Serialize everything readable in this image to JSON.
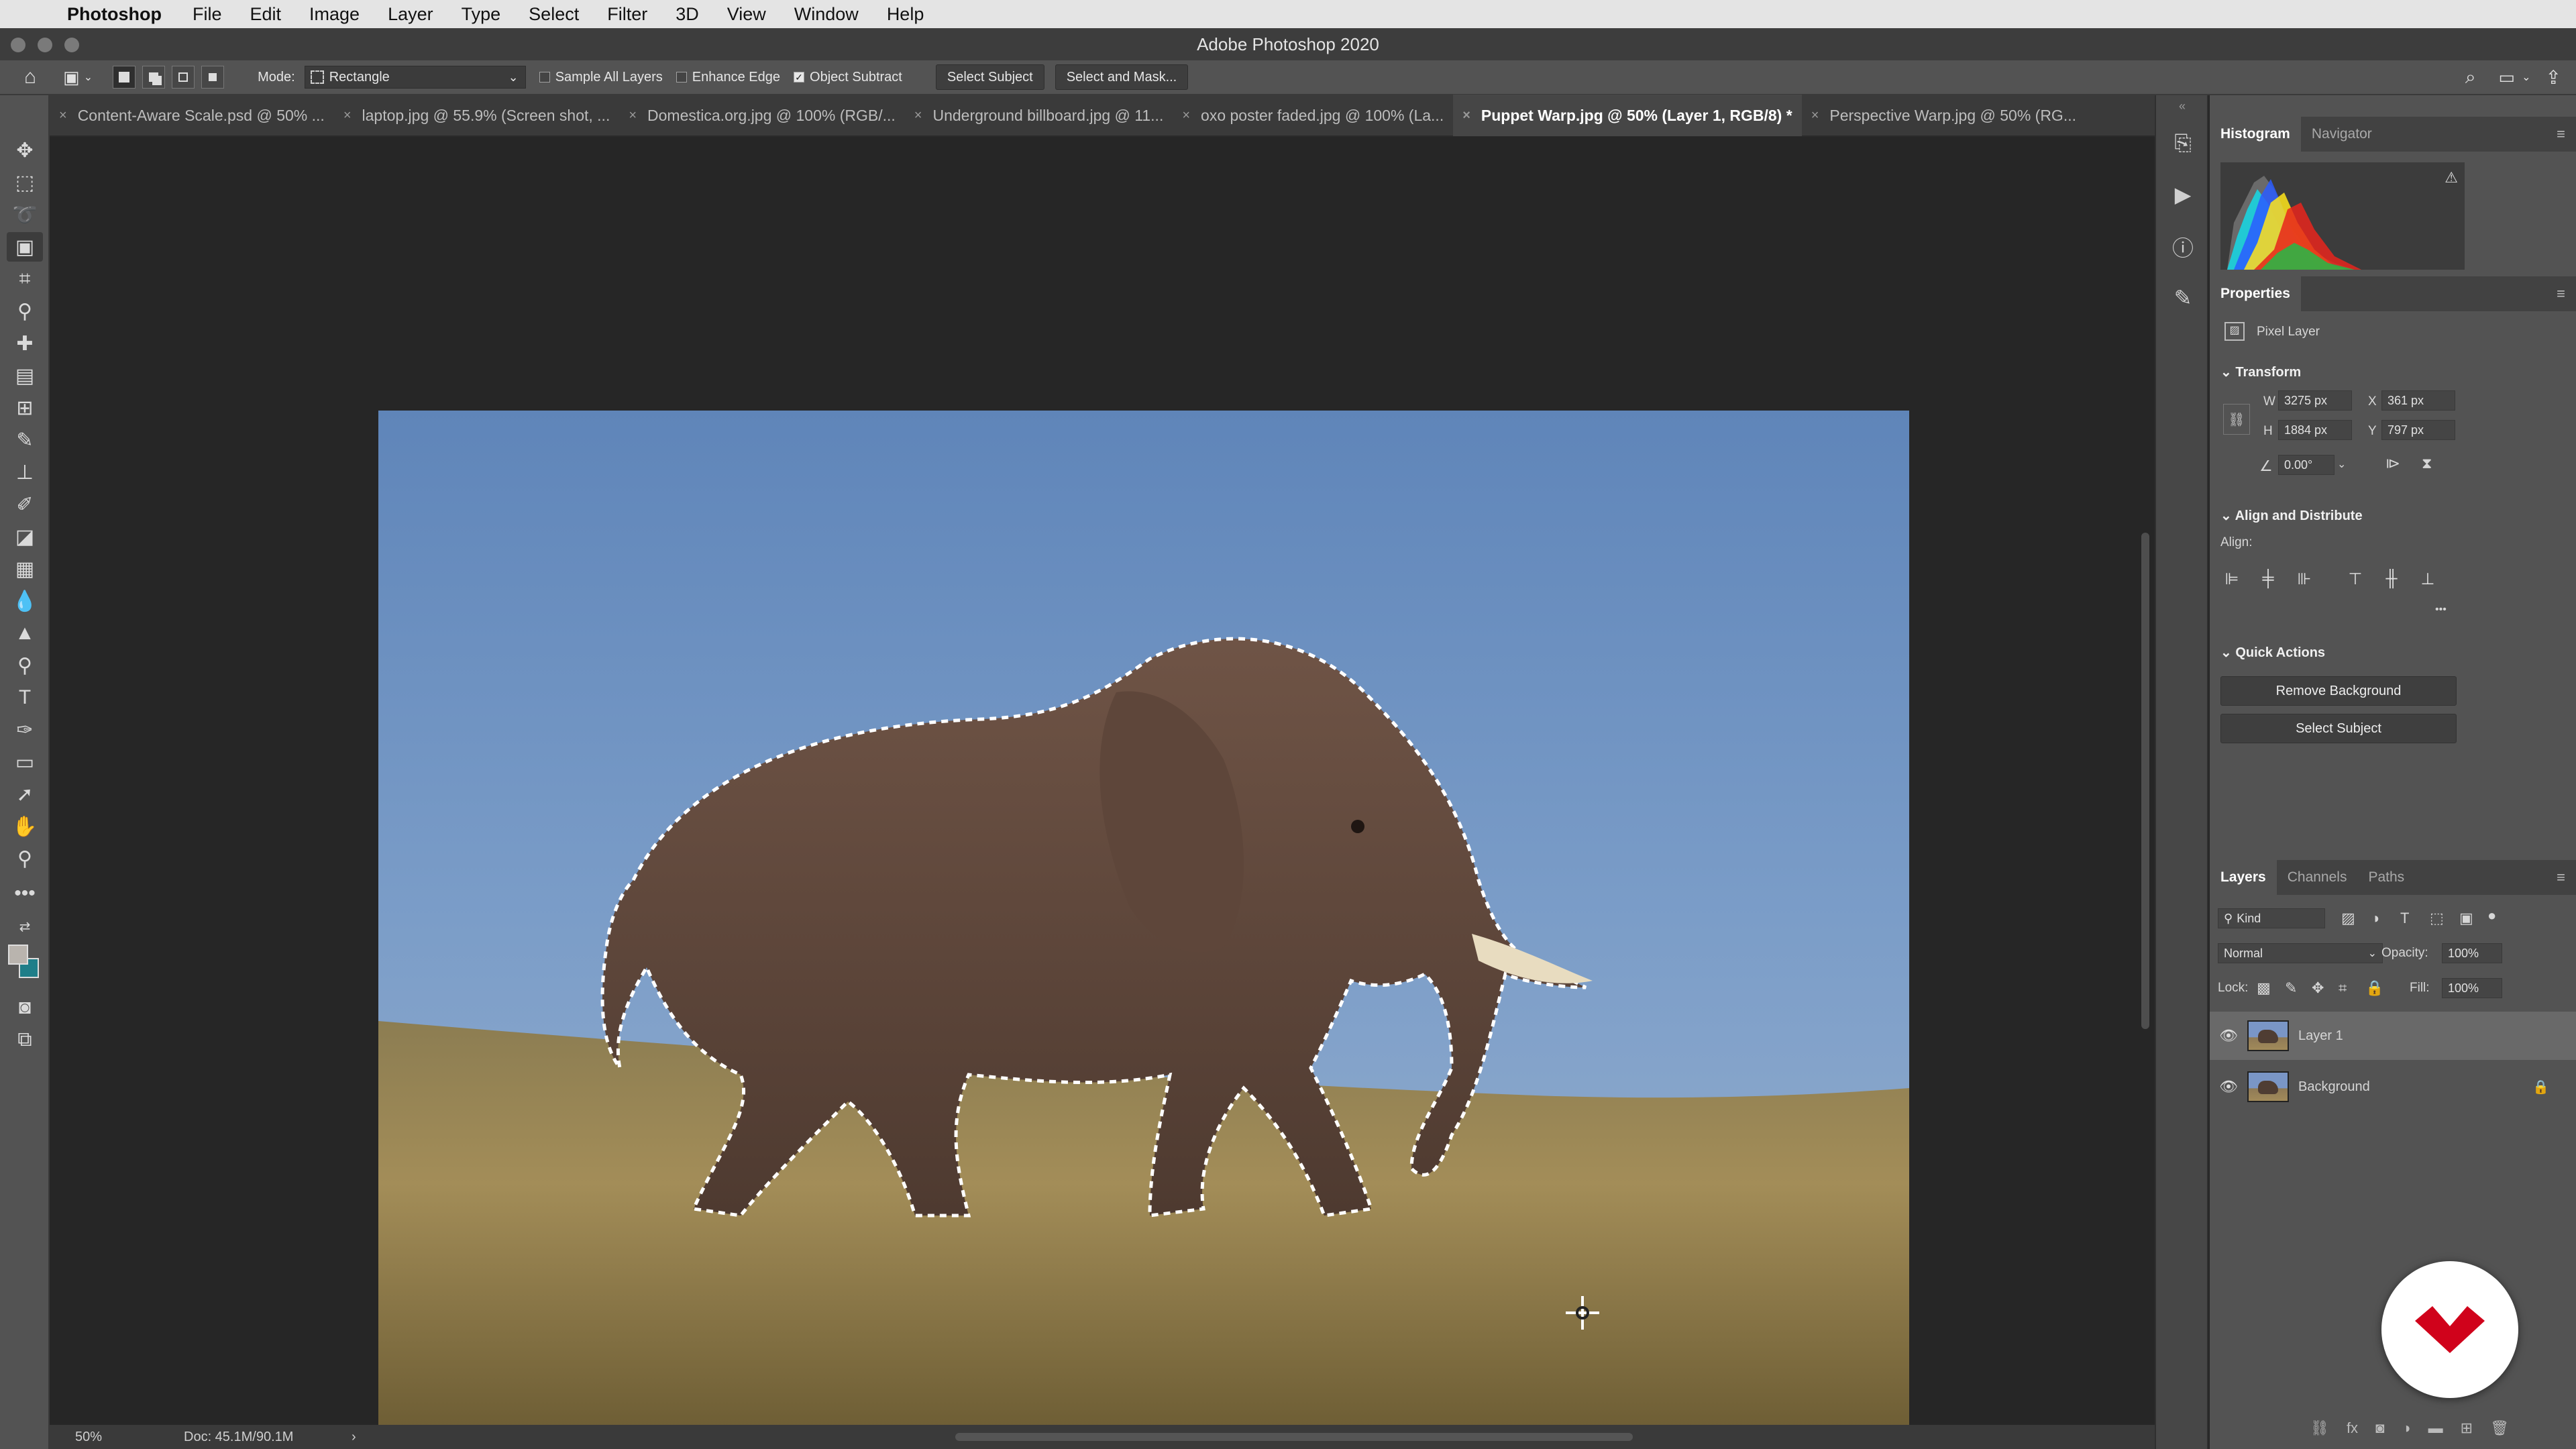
{
  "menubar": {
    "app_name": "Photoshop",
    "items": [
      "File",
      "Edit",
      "Image",
      "Layer",
      "Type",
      "Select",
      "Filter",
      "3D",
      "View",
      "Window",
      "Help"
    ]
  },
  "window": {
    "title": "Adobe Photoshop 2020"
  },
  "options": {
    "mode_label": "Mode:",
    "mode_value": "Rectangle",
    "sample_all_layers": "Sample All Layers",
    "sample_all_layers_checked": false,
    "enhance_edge": "Enhance Edge",
    "enhance_edge_checked": false,
    "object_subtract": "Object Subtract",
    "object_subtract_checked": true,
    "select_subject": "Select Subject",
    "select_and_mask": "Select and Mask..."
  },
  "tabs": [
    {
      "label": "Content-Aware Scale.psd @ 50% ...",
      "active": false
    },
    {
      "label": "laptop.jpg @ 55.9% (Screen shot, ...",
      "active": false
    },
    {
      "label": "Domestica.org.jpg @ 100% (RGB/...",
      "active": false
    },
    {
      "label": "Underground billboard.jpg @ 11...",
      "active": false
    },
    {
      "label": "oxo poster faded.jpg @ 100% (La...",
      "active": false
    },
    {
      "label": "Puppet Warp.jpg @ 50% (Layer 1, RGB/8) *",
      "active": true
    },
    {
      "label": "Perspective Warp.jpg @ 50% (RG...",
      "active": false
    }
  ],
  "status": {
    "zoom": "50%",
    "doc": "Doc: 45.1M/90.1M",
    "arrow": "›"
  },
  "histogram_panel": {
    "tab_histogram": "Histogram",
    "tab_navigator": "Navigator",
    "warning_icon": "warning-icon"
  },
  "properties": {
    "title": "Properties",
    "layer_type": "Pixel Layer",
    "transform_title": "Transform",
    "w_label": "W",
    "w_value": "3275 px",
    "x_label": "X",
    "x_value": "361 px",
    "h_label": "H",
    "h_value": "1884 px",
    "y_label": "Y",
    "y_value": "797 px",
    "angle_value": "0.00°",
    "align_title": "Align and Distribute",
    "align_label": "Align:",
    "more": "•••",
    "quick_actions_title": "Quick Actions",
    "remove_background": "Remove Background",
    "select_subject": "Select Subject"
  },
  "layers_panel": {
    "tab_layers": "Layers",
    "tab_channels": "Channels",
    "tab_paths": "Paths",
    "filter_kind": "Kind",
    "blend_mode": "Normal",
    "opacity_label": "Opacity:",
    "opacity_value": "100%",
    "lock_label": "Lock:",
    "fill_label": "Fill:",
    "fill_value": "100%",
    "layers": [
      {
        "name": "Layer 1",
        "selected": true,
        "locked": false
      },
      {
        "name": "Background",
        "selected": false,
        "locked": true
      }
    ]
  },
  "colors": {
    "foreground": "#b9b4ae",
    "background": "#1f7e89",
    "logo_red": "#d0021b"
  }
}
